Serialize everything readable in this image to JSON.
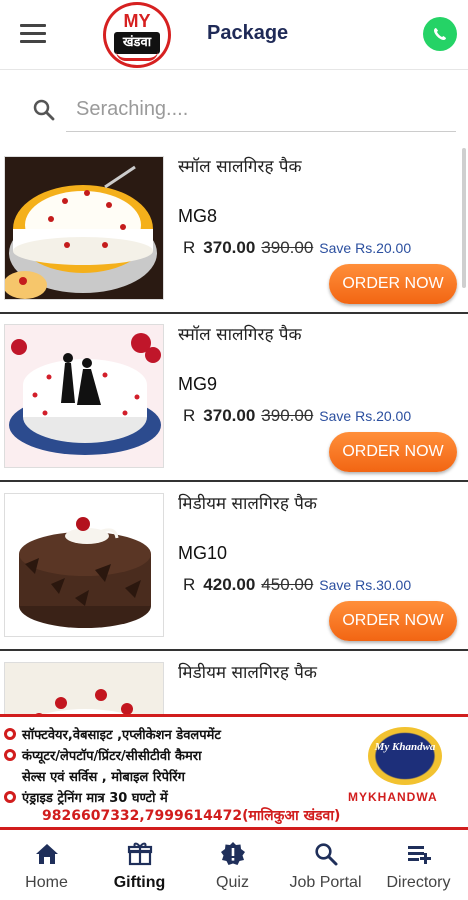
{
  "header": {
    "menu_icon": "hamburger-menu-icon",
    "logo_top": "MY",
    "logo_city": "खंडवा",
    "title": "Package",
    "whatsapp_icon": "whatsapp-icon"
  },
  "search": {
    "icon": "search-icon",
    "placeholder": "Seraching...."
  },
  "products": [
    {
      "name": "स्मॉल सालगिरह पैक",
      "code": "MG8",
      "currency": "R",
      "price": "370.00",
      "old_price": "390.00",
      "save": "Save Rs.20.00",
      "order_label": "ORDER NOW"
    },
    {
      "name": "स्मॉल सालगिरह पैक",
      "code": "MG9",
      "currency": "R",
      "price": "370.00",
      "old_price": "390.00",
      "save": "Save Rs.20.00",
      "order_label": "ORDER NOW"
    },
    {
      "name": "मिडीयम सालगिरह पैक",
      "code": "MG10",
      "currency": "R",
      "price": "420.00",
      "old_price": "450.00",
      "save": "Save Rs.30.00",
      "order_label": "ORDER NOW"
    },
    {
      "name": "मिडीयम सालगिरह पैक"
    }
  ],
  "ad": {
    "line1": "सॉफ्टवेयर,वेबसाइट ,एप्लीकेशन डेवलपमेंट",
    "line2": "कंप्यूटर/लेपटॉप/प्रिंटर/सीसीटीवी कैमरा",
    "line3": "सेल्स एवं सर्विस , मोबाइल रिपेरिंग",
    "line4": "एंड्राइड ट्रेनिंग मात्र 30 घण्टो में",
    "phone": "9826607332,7999614472(मालिकुआ खंडवा)",
    "brand": "MYKHANDWA",
    "badge_text": "My Khandwa"
  },
  "nav": {
    "items": [
      {
        "label": "Home",
        "icon": "home-icon"
      },
      {
        "label": "Gifting",
        "icon": "gift-icon",
        "active": true
      },
      {
        "label": "Quiz",
        "icon": "quiz-badge-icon"
      },
      {
        "label": "Job Portal",
        "icon": "search-icon"
      },
      {
        "label": "Directory",
        "icon": "directory-icon"
      }
    ]
  },
  "colors": {
    "accent": "#f26513",
    "title": "#1f2a57",
    "save": "#2b4f9f",
    "ad_red": "#d11d1d",
    "whatsapp": "#25d366"
  }
}
